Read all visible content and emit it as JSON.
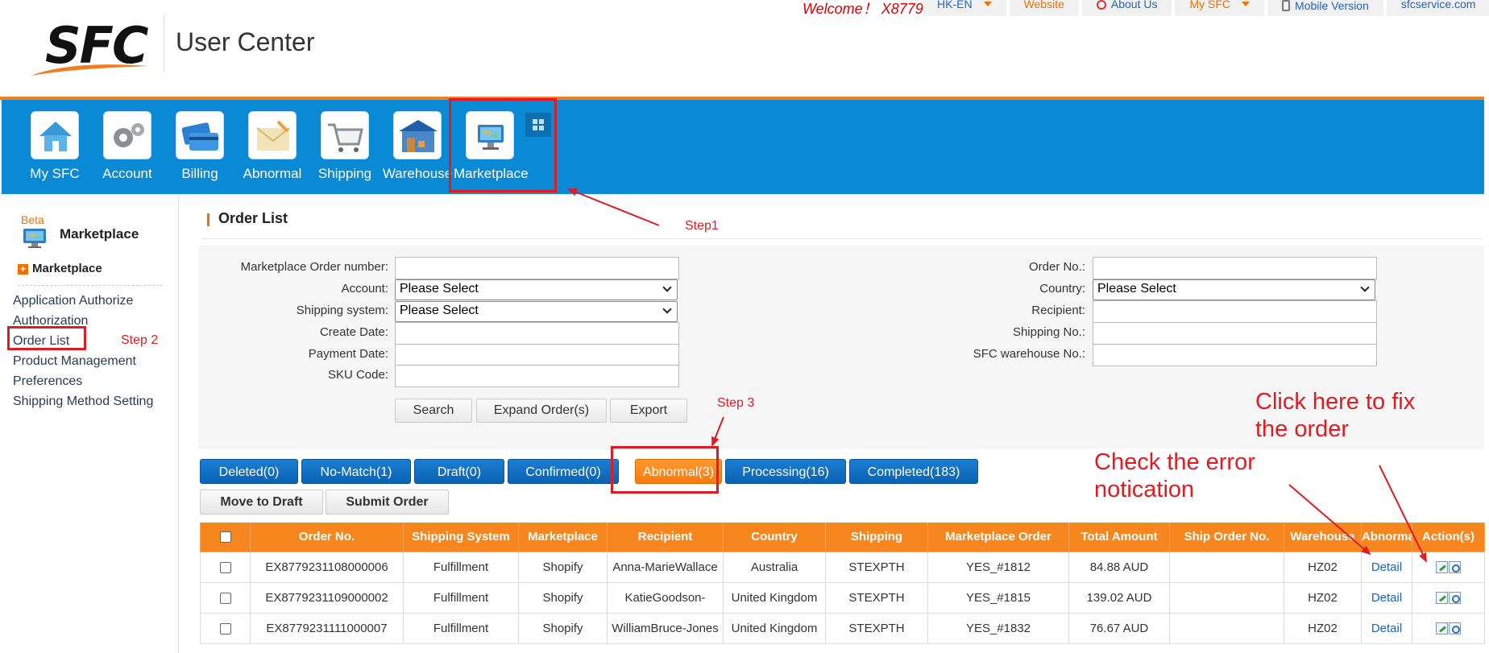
{
  "header": {
    "logo_text": "SFC",
    "title": "User Center",
    "welcome": "Welcome！ X8779",
    "links": [
      {
        "label": "HK-EN",
        "has_caret": true
      },
      {
        "label": "Website"
      },
      {
        "label": "About Us",
        "icon": "weibo-icon"
      },
      {
        "label": "My SFC",
        "has_caret": true
      },
      {
        "label": "Mobile Version",
        "icon": "phone-icon"
      },
      {
        "label": "sfcservice.com"
      }
    ]
  },
  "nav": {
    "items": [
      {
        "label": "My SFC",
        "icon": "home-icon"
      },
      {
        "label": "Account",
        "icon": "gears-icon"
      },
      {
        "label": "Billing",
        "icon": "cards-icon"
      },
      {
        "label": "Abnormal",
        "icon": "envelope-icon"
      },
      {
        "label": "Shipping",
        "icon": "cart-icon"
      },
      {
        "label": "Warehouse",
        "icon": "warehouse-icon"
      },
      {
        "label": "Marketplace",
        "icon": "monitor-icon"
      }
    ]
  },
  "sidebar": {
    "beta": "Beta",
    "title": "Marketplace",
    "section": "Marketplace",
    "items": [
      {
        "label": "Application Authorize"
      },
      {
        "label": "Authorization"
      },
      {
        "label": "Order List"
      },
      {
        "label": "Product Management"
      },
      {
        "label": "Preferences"
      },
      {
        "label": "Shipping Method Setting"
      }
    ]
  },
  "main": {
    "title": "Order List",
    "form": {
      "marketplace_order_number": {
        "label": "Marketplace Order number:",
        "value": ""
      },
      "account": {
        "label": "Account:",
        "value": "Please Select"
      },
      "shipping_system": {
        "label": "Shipping system:",
        "value": "Please Select"
      },
      "create_date": {
        "label": "Create Date:",
        "value": ""
      },
      "payment_date": {
        "label": "Payment Date:",
        "value": ""
      },
      "sku_code": {
        "label": "SKU Code:",
        "value": ""
      },
      "order_no": {
        "label": "Order No.:",
        "value": ""
      },
      "country": {
        "label": "Country:",
        "value": "Please Select"
      },
      "recipient": {
        "label": "Recipient:",
        "value": ""
      },
      "shipping_no": {
        "label": "Shipping No.:",
        "value": ""
      },
      "sfc_warehouse_no": {
        "label": "SFC warehouse No.:",
        "value": ""
      }
    },
    "buttons": {
      "search": "Search",
      "expand": "Expand Order(s)",
      "export": "Export"
    },
    "tabs": [
      {
        "label": "Deleted(0)"
      },
      {
        "label": "No-Match(1)"
      },
      {
        "label": "Draft(0)"
      },
      {
        "label": "Confirmed(0)"
      },
      {
        "label": "Abnormal(3)",
        "active": true
      },
      {
        "label": "Processing(16)"
      },
      {
        "label": "Completed(183)"
      }
    ],
    "actions": {
      "move_to_draft": "Move to Draft",
      "submit_order": "Submit Order"
    },
    "table": {
      "columns": [
        "Order No.",
        "Shipping System",
        "Marketplace",
        "Recipient",
        "Country",
        "Shipping",
        "Marketplace Order",
        "Total Amount",
        "Ship Order No.",
        "Warehouse",
        "Abnormal",
        "Action(s)"
      ],
      "rows": [
        {
          "order_no": "EX8779231108000006",
          "shipping_system": "Fulfillment",
          "marketplace": "Shopify",
          "recipient": "Anna-MarieWallace",
          "country": "Australia",
          "shipping": "STEXPTH",
          "marketplace_order": "YES_#1812",
          "total": "84.88 AUD",
          "ship_order_no": "",
          "warehouse": "HZ02",
          "abnormal": "Detail"
        },
        {
          "order_no": "EX8779231109000002",
          "shipping_system": "Fulfillment",
          "marketplace": "Shopify",
          "recipient": "KatieGoodson-",
          "country": "United Kingdom",
          "shipping": "STEXPTH",
          "marketplace_order": "YES_#1815",
          "total": "139.02 AUD",
          "ship_order_no": "",
          "warehouse": "HZ02",
          "abnormal": "Detail"
        },
        {
          "order_no": "EX8779231111000007",
          "shipping_system": "Fulfillment",
          "marketplace": "Shopify",
          "recipient": "WilliamBruce-Jones",
          "country": "United Kingdom",
          "shipping": "STEXPTH",
          "marketplace_order": "YES_#1832",
          "total": "76.67 AUD",
          "ship_order_no": "",
          "warehouse": "HZ02",
          "abnormal": "Detail"
        }
      ]
    }
  },
  "annotations": {
    "step1": "Step1",
    "step2": "Step 2",
    "step3": "Step 3",
    "fix_line1": "Click here to fix",
    "fix_line2": "the order",
    "check_line1": "Check the error",
    "check_line2": "notication"
  },
  "colors": {
    "nav_blue": "#0a89d4",
    "accent_orange": "#f27c1f",
    "annotation_red": "#e01b22",
    "tab_blue": "#0b62b2"
  }
}
